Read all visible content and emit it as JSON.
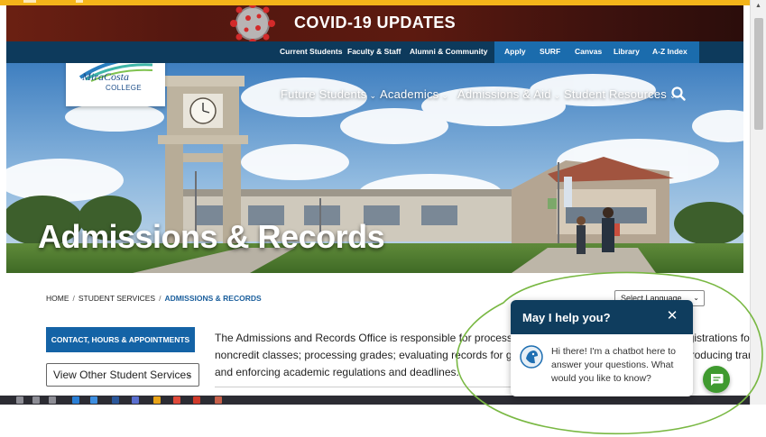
{
  "colors": {
    "navy": "#0d3a5c",
    "accent_blue": "#1463a6",
    "chat_header": "#0f3d5e",
    "chat_button": "#3f9a2f",
    "annotation_ring": "#79b843"
  },
  "banner": {
    "title": "COVID-19 UPDATES"
  },
  "utility_nav": {
    "current_students": "Current Students",
    "faculty_staff": "Faculty & Staff",
    "alumni": "Alumni & Community",
    "apply": "Apply",
    "surf": "SURF",
    "canvas": "Canvas",
    "library": "Library",
    "az_index": "A-Z Index"
  },
  "logo": {
    "line1": "MiraCosta",
    "line2": "COLLEGE"
  },
  "main_nav": {
    "future_students": "Future Students",
    "academics": "Academics",
    "admissions_aid": "Admissions & Aid",
    "student_resources": "Student Resources",
    "search_icon": "search-icon"
  },
  "hero": {
    "title": "Admissions & Records"
  },
  "breadcrumb": {
    "home": "HOME",
    "student_services": "STUDENT SERVICES",
    "current": "ADMISSIONS & RECORDS",
    "separator": "/"
  },
  "language_select": {
    "value": "Select Language"
  },
  "sidebar": {
    "contact_button": "CONTACT, HOURS & APPOINTMENTS",
    "services_select": "View Other Student Services"
  },
  "intro": {
    "line1": "The Admissions and Records Office is responsible for processing applications for admission and registrations for credit and",
    "line2": "noncredit classes; processing grades; evaluating records for graduation, certificates, and transfer; producing transcripts,",
    "line3": "and enforcing academic regulations and deadlines."
  },
  "chatbot": {
    "title": "May I help you?",
    "close": "✕",
    "message": "Hi there! I'm a chatbot here to answer your questions. What would you like to know?",
    "launcher_icon": "chat-bubble-icon"
  }
}
